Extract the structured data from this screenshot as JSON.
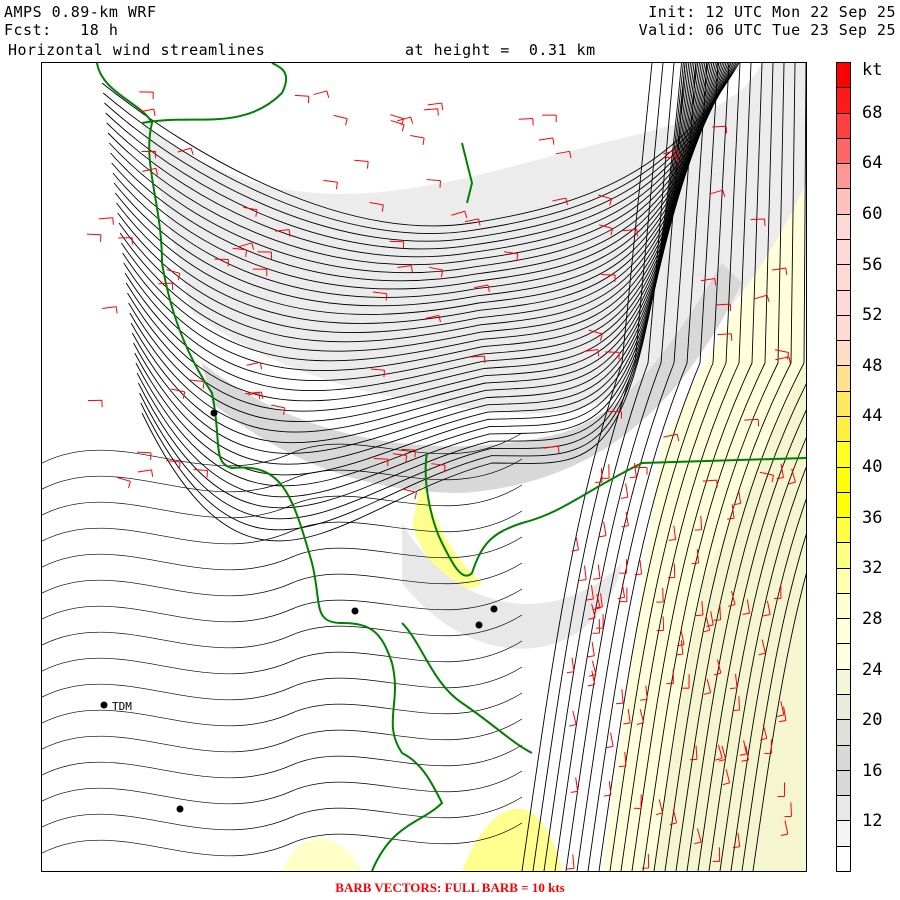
{
  "header": {
    "model": "AMPS 0.89-km WRF",
    "forecast": "Fcst:   18 h",
    "field": "Horizontal wind streamlines",
    "height": "at height =  0.31 km",
    "init": "Init: 12 UTC Mon 22 Sep 25",
    "valid": "Valid: 06 UTC Tue 23 Sep 25"
  },
  "map": {
    "station_label": "TDM",
    "coastline_color": "#008000",
    "barb_color": "#ff0000",
    "streamline_color": "#000000"
  },
  "colorbar": {
    "unit": "kt",
    "labels": [
      "68",
      "64",
      "60",
      "56",
      "52",
      "48",
      "44",
      "40",
      "36",
      "32",
      "28",
      "24",
      "20",
      "16",
      "12"
    ],
    "colors": [
      "#ff0000",
      "#ff1a1a",
      "#ff4040",
      "#ff6666",
      "#ff9999",
      "#ffc0c0",
      "#ffd8d8",
      "#ffd8d8",
      "#ffd8d8",
      "#ffd8d8",
      "#ffd8d8",
      "#ffdcc8",
      "#ffe08c",
      "#ffe860",
      "#fff040",
      "#ffff20",
      "#ffff00",
      "#ffff00",
      "#ffff40",
      "#ffff80",
      "#ffffb0",
      "#ffffd0",
      "#ffffd8",
      "#ffffe0",
      "#f5f5dc",
      "#ebebdc",
      "#e0e0d8",
      "#d8d8d8",
      "#d8d8d8",
      "#e8e8e8",
      "#f4f4f4",
      "#ffffff"
    ]
  },
  "caption": "BARB VECTORS:  FULL BARB = 10 kts"
}
